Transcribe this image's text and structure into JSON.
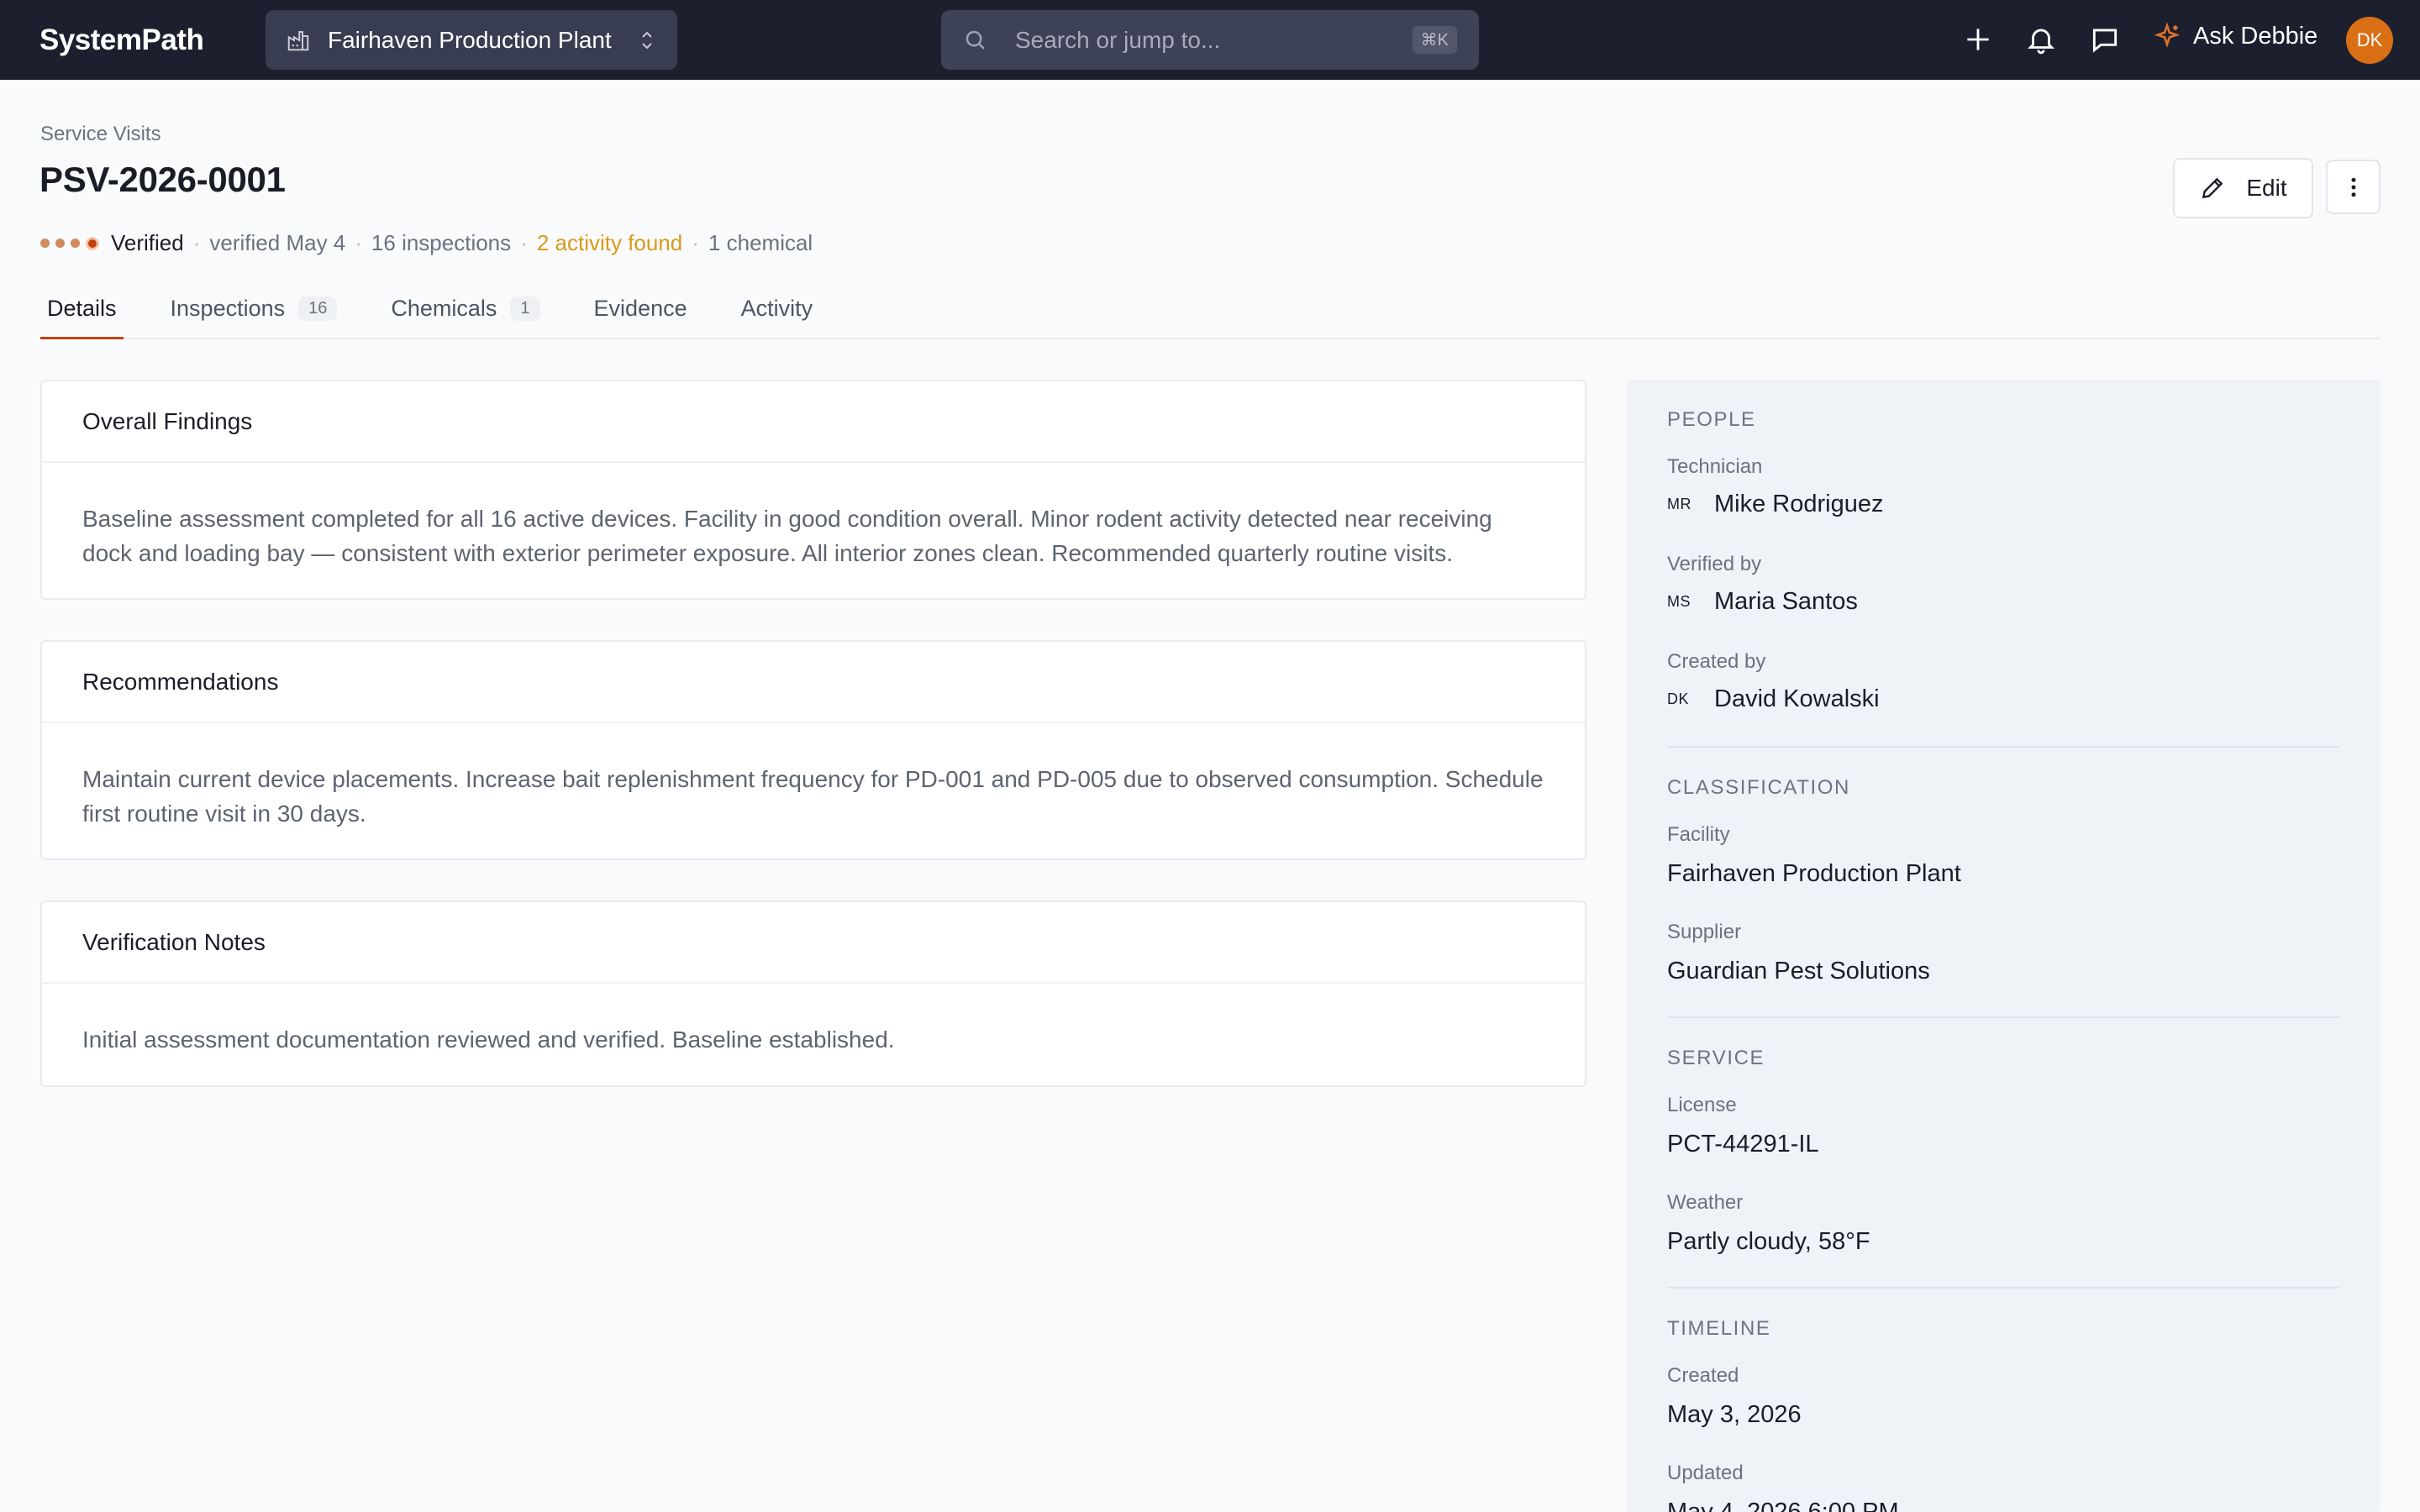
{
  "app": {
    "name": "SystemPath"
  },
  "topbar": {
    "facility": "Fairhaven Production Plant",
    "search_placeholder": "Search or jump to...",
    "search_shortcut": "⌘K",
    "assistant_label": "Ask Debbie",
    "user_initials": "DK"
  },
  "header": {
    "breadcrumb": "Service Visits",
    "title": "PSV-2026-0001",
    "edit_label": "Edit",
    "status": {
      "label": "Verified",
      "verified_on": "verified May 4",
      "inspections": "16 inspections",
      "activity": "2 activity found",
      "chemicals": "1 chemical"
    }
  },
  "tabs": [
    {
      "label": "Details",
      "count": null,
      "active": true
    },
    {
      "label": "Inspections",
      "count": "16",
      "active": false
    },
    {
      "label": "Chemicals",
      "count": "1",
      "active": false
    },
    {
      "label": "Evidence",
      "count": null,
      "active": false
    },
    {
      "label": "Activity",
      "count": null,
      "active": false
    }
  ],
  "cards": [
    {
      "title": "Overall Findings",
      "body": "Baseline assessment completed for all 16 active devices. Facility in good condition overall. Minor rodent activity detected near receiving dock and loading bay — consistent with exterior perimeter exposure. All interior zones clean. Recommended quarterly routine visits."
    },
    {
      "title": "Recommendations",
      "body": "Maintain current device placements. Increase bait replenishment frequency for PD-001 and PD-005 due to observed consumption. Schedule first routine visit in 30 days."
    },
    {
      "title": "Verification Notes",
      "body": "Initial assessment documentation reviewed and verified. Baseline established."
    }
  ],
  "side": {
    "people": {
      "title": "PEOPLE",
      "technician_label": "Technician",
      "technician_initials": "MR",
      "technician": "Mike Rodriguez",
      "verified_label": "Verified by",
      "verified_initials": "MS",
      "verified_by": "Maria Santos",
      "created_label": "Created by",
      "created_initials": "DK",
      "created_by": "David Kowalski"
    },
    "classification": {
      "title": "CLASSIFICATION",
      "facility_label": "Facility",
      "facility": "Fairhaven Production Plant",
      "supplier_label": "Supplier",
      "supplier": "Guardian Pest Solutions"
    },
    "service": {
      "title": "SERVICE",
      "license_label": "License",
      "license": "PCT-44291-IL",
      "weather_label": "Weather",
      "weather": "Partly cloudy, 58°F"
    },
    "timeline": {
      "title": "TIMELINE",
      "created_label": "Created",
      "created": "May 3, 2026",
      "updated_label": "Updated",
      "updated": "May 4, 2026 6:00 PM"
    }
  },
  "colors": {
    "topbar": "#1c1f2e",
    "accent": "#c2410c",
    "warning": "#d99a1b",
    "avatar": "#d96f15"
  }
}
